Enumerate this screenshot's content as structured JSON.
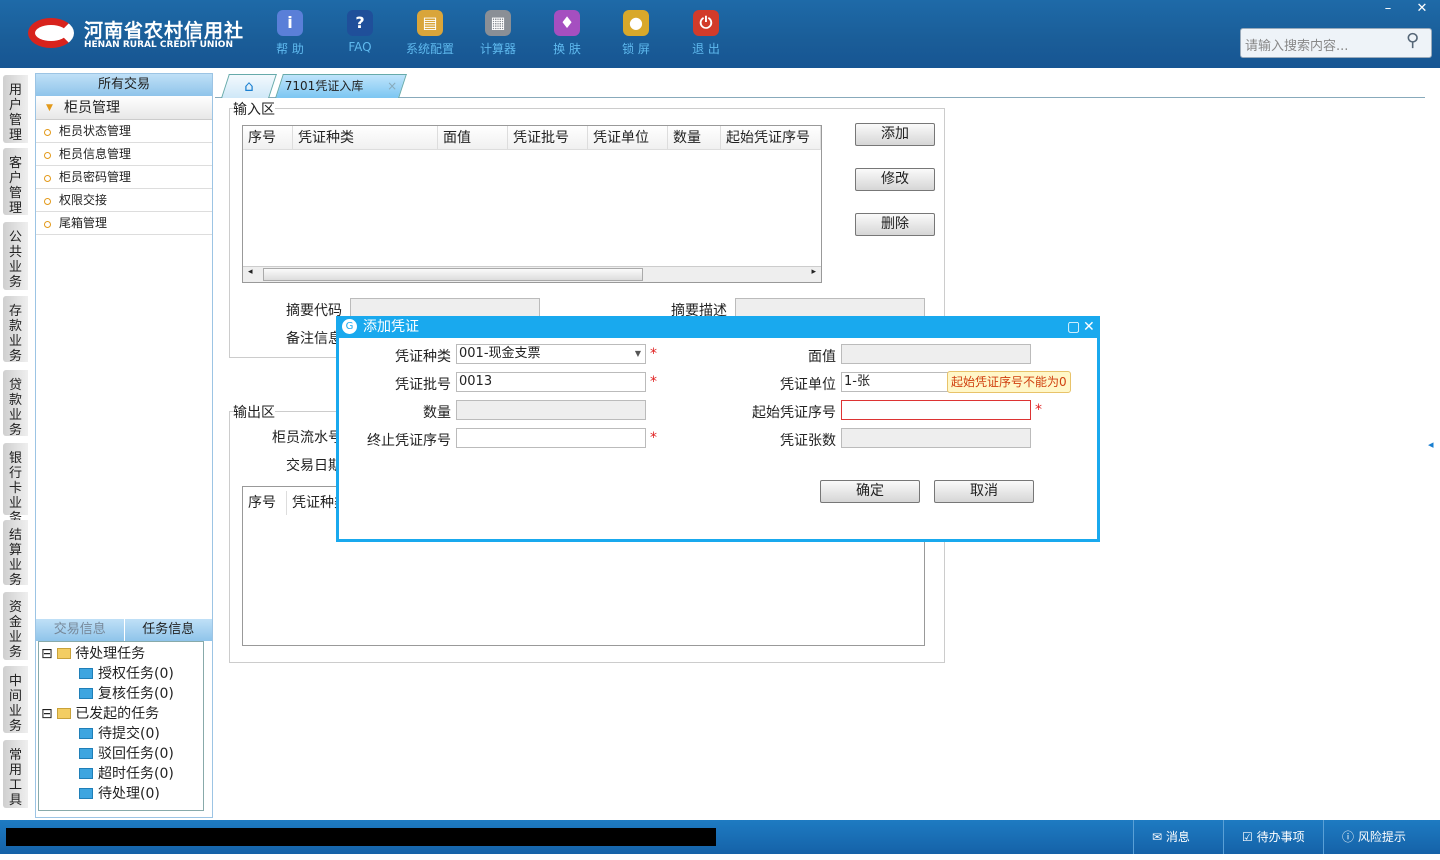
{
  "header": {
    "brand_cn": "河南省农村信用社",
    "brand_en": "HENAN RURAL CREDIT UNION",
    "tools": [
      {
        "label": "帮 助",
        "icon": "info-icon",
        "color": "#5a7fd8",
        "glyph": "i"
      },
      {
        "label": "FAQ",
        "icon": "question-icon",
        "color": "#1f4f9a",
        "glyph": "?"
      },
      {
        "label": "系统配置",
        "icon": "toolbox-icon",
        "color": "#d9a53a",
        "glyph": "▤"
      },
      {
        "label": "计算器",
        "icon": "calculator-icon",
        "color": "#8a8f96",
        "glyph": "▦"
      },
      {
        "label": "换 肤",
        "icon": "shirt-icon",
        "color": "#a54fc0",
        "glyph": "♦"
      },
      {
        "label": "锁 屏",
        "icon": "lock-icon",
        "color": "#d8a82a",
        "glyph": "●"
      },
      {
        "label": "退 出",
        "icon": "power-icon",
        "color": "#d23b2a",
        "glyph": "⏻"
      }
    ],
    "search_placeholder": "请输入搜索内容...",
    "minimize": "–",
    "close": "✕"
  },
  "vtabs": [
    "用户管理",
    "客户管理",
    "公共业务",
    "存款业务",
    "贷款业务",
    "银行卡业务",
    "结算业务",
    "资金业务",
    "中间业务",
    "常用工具"
  ],
  "left_panel": {
    "title": "所有交易",
    "group": "柜员管理",
    "items": [
      "柜员状态管理",
      "柜员信息管理",
      "柜员密码管理",
      "权限交接",
      "尾箱管理"
    ],
    "tabs": [
      "交易信息",
      "任务信息"
    ],
    "tree": [
      {
        "label": "待处理任务",
        "children": [
          "授权任务(0)",
          "复核任务(0)"
        ]
      },
      {
        "label": "已发起的任务",
        "children": [
          "待提交(0)",
          "驳回任务(0)",
          "超时任务(0)",
          "待处理(0)"
        ]
      }
    ]
  },
  "tabs": {
    "active": "7101凭证入库",
    "close": "×"
  },
  "input_area": {
    "legend": "输入区",
    "columns": [
      "序号",
      "凭证种类",
      "面值",
      "凭证批号",
      "凭证单位",
      "数量",
      "起始凭证序号"
    ],
    "buttons": {
      "add": "添加",
      "edit": "修改",
      "delete": "删除"
    },
    "summary_code": "摘要代码",
    "summary_desc": "摘要描述",
    "remark": "备注信息"
  },
  "output_area": {
    "legend": "输出区",
    "teller_serial": "柜员流水号",
    "trade_date": "交易日期",
    "columns": [
      "序号",
      "凭证种类"
    ]
  },
  "dialog": {
    "title": "添加凭证",
    "voucher_type_label": "凭证种类",
    "voucher_type_value": "001-现金支票",
    "batch_label": "凭证批号",
    "batch_value": "0013",
    "quantity_label": "数量",
    "end_seq_label": "终止凭证序号",
    "face_label": "面值",
    "unit_label": "凭证单位",
    "unit_value": "1-张",
    "start_seq_label": "起始凭证序号",
    "count_label": "凭证张数",
    "tooltip": "起始凭证序号不能为0",
    "required": "*",
    "ok": "确定",
    "cancel": "取消"
  },
  "status": {
    "message": "消息",
    "todo": "待办事项",
    "risk": "风险提示"
  }
}
